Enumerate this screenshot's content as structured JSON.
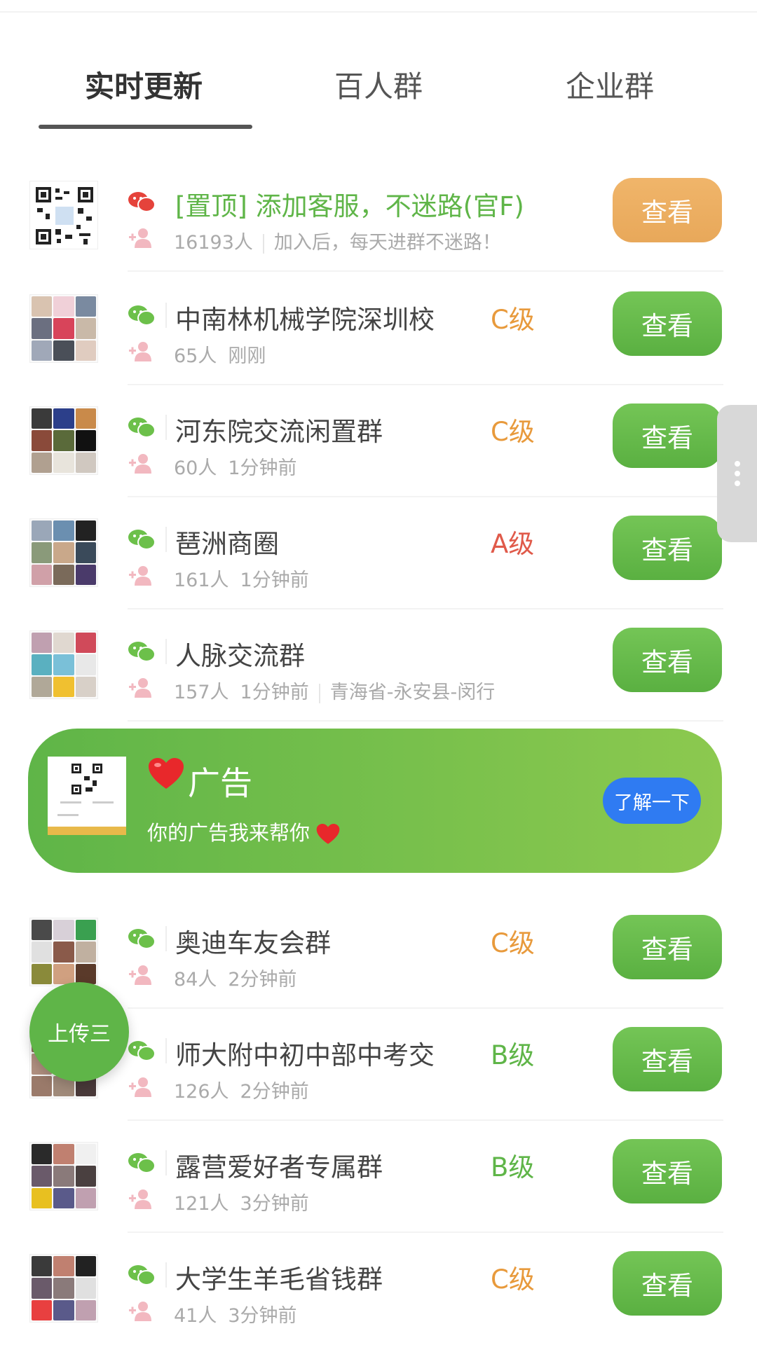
{
  "tabs": [
    {
      "label": "实时更新",
      "active": true
    },
    {
      "label": "百人群",
      "active": false
    },
    {
      "label": "企业群",
      "active": false
    }
  ],
  "pinned": {
    "name": "[置顶] 添加客服，不迷路(官F)",
    "members": "16193人",
    "desc": "加入后，每天进群不迷路！",
    "button": "查看"
  },
  "groups": [
    {
      "name": "中南林机械学院深圳校",
      "level": "C级",
      "level_color": "#e89a3c",
      "members": "65人",
      "time": "刚刚",
      "location": "",
      "button": "查看"
    },
    {
      "name": "河东院交流闲置群",
      "level": "C级",
      "level_color": "#e89a3c",
      "members": "60人",
      "time": "1分钟前",
      "location": "",
      "button": "查看"
    },
    {
      "name": "琶洲商圈",
      "level": "A级",
      "level_color": "#e05a4a",
      "members": "161人",
      "time": "1分钟前",
      "location": "",
      "button": "查看"
    },
    {
      "name": "人脉交流群",
      "level": "",
      "level_color": "#e89a3c",
      "members": "157人",
      "time": "1分钟前",
      "location": "青海省-永安县-闵行",
      "button": "查看"
    }
  ],
  "ad": {
    "title": "广告",
    "subtitle": "你的广告我来帮你",
    "button": "了解一下"
  },
  "groups2": [
    {
      "name": "奥迪车友会群",
      "level": "C级",
      "level_color": "#e89a3c",
      "members": "84人",
      "time": "2分钟前",
      "button": "查看"
    },
    {
      "name": "师大附中初中部中考交",
      "level": "B级",
      "level_color": "#5fb548",
      "members": "126人",
      "time": "2分钟前",
      "button": "查看"
    },
    {
      "name": "露营爱好者专属群",
      "level": "B级",
      "level_color": "#5fb548",
      "members": "121人",
      "time": "3分钟前",
      "button": "查看"
    },
    {
      "name": "大学生羊毛省钱群",
      "level": "C级",
      "level_color": "#e89a3c",
      "members": "41人",
      "time": "3分钟前",
      "button": "查看"
    }
  ],
  "fab": {
    "label": "上传三"
  },
  "colors": {
    "accent_green": "#5fb548",
    "pinned_orange": "#e8a85a",
    "ad_blue": "#2f7bf2"
  }
}
